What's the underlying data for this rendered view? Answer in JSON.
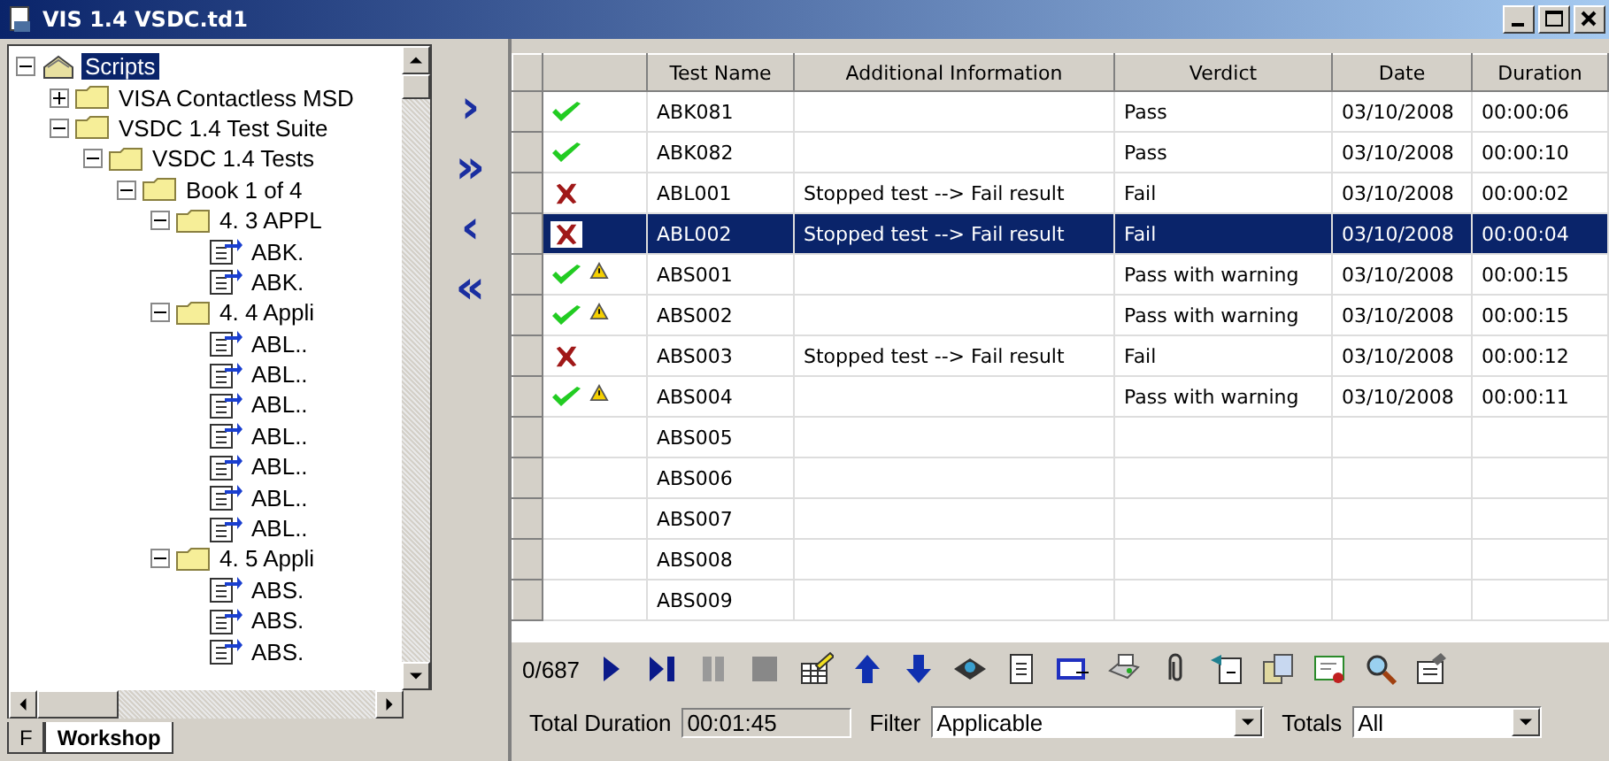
{
  "window": {
    "title": "VIS 1.4 VSDC.td1"
  },
  "tree": [
    {
      "kind": "root",
      "label": "Scripts",
      "selected": true,
      "expanded": true,
      "children": [
        {
          "kind": "folder",
          "label": "VISA Contactless MSD",
          "selected": false,
          "expanded": false
        },
        {
          "kind": "folder",
          "label": "VSDC 1.4 Test Suite",
          "selected": false,
          "expanded": true,
          "children": [
            {
              "kind": "folder",
              "label": "VSDC 1.4 Tests",
              "selected": false,
              "expanded": true,
              "children": [
                {
                  "kind": "folder",
                  "label": "Book 1 of 4",
                  "selected": false,
                  "expanded": true,
                  "children": [
                    {
                      "kind": "folder",
                      "label": "4. 3 APPL",
                      "selected": false,
                      "expanded": true,
                      "children": [
                        {
                          "kind": "script",
                          "label": "ABK.",
                          "selected": false
                        },
                        {
                          "kind": "script",
                          "label": "ABK.",
                          "selected": false
                        }
                      ]
                    },
                    {
                      "kind": "folder",
                      "label": "4. 4 Appli",
                      "selected": false,
                      "expanded": true,
                      "children": [
                        {
                          "kind": "script",
                          "label": "ABL..",
                          "selected": false
                        },
                        {
                          "kind": "script",
                          "label": "ABL..",
                          "selected": false
                        },
                        {
                          "kind": "script",
                          "label": "ABL..",
                          "selected": false
                        },
                        {
                          "kind": "script",
                          "label": "ABL..",
                          "selected": false
                        },
                        {
                          "kind": "script",
                          "label": "ABL..",
                          "selected": false
                        },
                        {
                          "kind": "script",
                          "label": "ABL..",
                          "selected": false
                        },
                        {
                          "kind": "script",
                          "label": "ABL..",
                          "selected": false
                        }
                      ]
                    },
                    {
                      "kind": "folder",
                      "label": "4. 5 Appli",
                      "selected": false,
                      "expanded": true,
                      "children": [
                        {
                          "kind": "script",
                          "label": "ABS.",
                          "selected": false
                        },
                        {
                          "kind": "script",
                          "label": "ABS.",
                          "selected": false
                        },
                        {
                          "kind": "script",
                          "label": "ABS.",
                          "selected": false
                        }
                      ]
                    }
                  ]
                }
              ]
            }
          ]
        }
      ]
    }
  ],
  "left_tabs": [
    {
      "label": "F",
      "selected": false
    },
    {
      "label": "Workshop",
      "selected": true
    }
  ],
  "move_buttons": [
    {
      "label": "›"
    },
    {
      "label": "»"
    },
    {
      "label": "‹"
    },
    {
      "label": "«"
    }
  ],
  "table": {
    "columns": [
      "Test Name",
      "Additional Information",
      "Verdict",
      "Date",
      "Duration"
    ],
    "rows": [
      {
        "kind": "pass",
        "selected": false,
        "cells": [
          "ABK081",
          "",
          "Pass",
          "03/10/2008",
          "00:00:06"
        ]
      },
      {
        "kind": "pass",
        "selected": false,
        "cells": [
          "ABK082",
          "",
          "Pass",
          "03/10/2008",
          "00:00:10"
        ]
      },
      {
        "kind": "fail",
        "selected": false,
        "cells": [
          "ABL001",
          "Stopped test --> Fail result",
          "Fail",
          "03/10/2008",
          "00:00:02"
        ]
      },
      {
        "kind": "fail",
        "selected": true,
        "cells": [
          "ABL002",
          "Stopped test --> Fail result",
          "Fail",
          "03/10/2008",
          "00:00:04"
        ]
      },
      {
        "kind": "warning",
        "selected": false,
        "cells": [
          "ABS001",
          "",
          "Pass with warning",
          "03/10/2008",
          "00:00:15"
        ]
      },
      {
        "kind": "warning",
        "selected": false,
        "cells": [
          "ABS002",
          "",
          "Pass with warning",
          "03/10/2008",
          "00:00:15"
        ]
      },
      {
        "kind": "fail",
        "selected": false,
        "cells": [
          "ABS003",
          "Stopped test --> Fail result",
          "Fail",
          "03/10/2008",
          "00:00:12"
        ]
      },
      {
        "kind": "warning",
        "selected": false,
        "cells": [
          "ABS004",
          "",
          "Pass with warning",
          "03/10/2008",
          "00:00:11"
        ]
      },
      {
        "kind": "none",
        "selected": false,
        "cells": [
          "ABS005",
          "",
          "",
          "",
          ""
        ]
      },
      {
        "kind": "none",
        "selected": false,
        "cells": [
          "ABS006",
          "",
          "",
          "",
          ""
        ]
      },
      {
        "kind": "none",
        "selected": false,
        "cells": [
          "ABS007",
          "",
          "",
          "",
          ""
        ]
      },
      {
        "kind": "none",
        "selected": false,
        "cells": [
          "ABS008",
          "",
          "",
          "",
          ""
        ]
      },
      {
        "kind": "none",
        "selected": false,
        "cells": [
          "ABS009",
          "",
          "",
          "",
          ""
        ]
      }
    ]
  },
  "toolbar": {
    "counter": "0/687",
    "tools": [
      {
        "kind": "play"
      },
      {
        "kind": "step"
      },
      {
        "kind": "pause",
        "disabled": true
      },
      {
        "kind": "stop",
        "disabled": true
      },
      {
        "kind": "edit"
      },
      {
        "kind": "up"
      },
      {
        "kind": "down"
      },
      {
        "kind": "disk"
      },
      {
        "kind": "notepad"
      },
      {
        "kind": "window"
      },
      {
        "kind": "printer"
      },
      {
        "kind": "clip"
      },
      {
        "kind": "doc"
      },
      {
        "kind": "copy"
      },
      {
        "kind": "certificate"
      },
      {
        "kind": "search"
      },
      {
        "kind": "properties"
      }
    ]
  },
  "footer": {
    "total_label": "Total Duration",
    "total_value": "00:01:45",
    "filter_label": "Filter",
    "filter_value": "Applicable",
    "totals_label": "Totals",
    "totals_value": "All"
  }
}
